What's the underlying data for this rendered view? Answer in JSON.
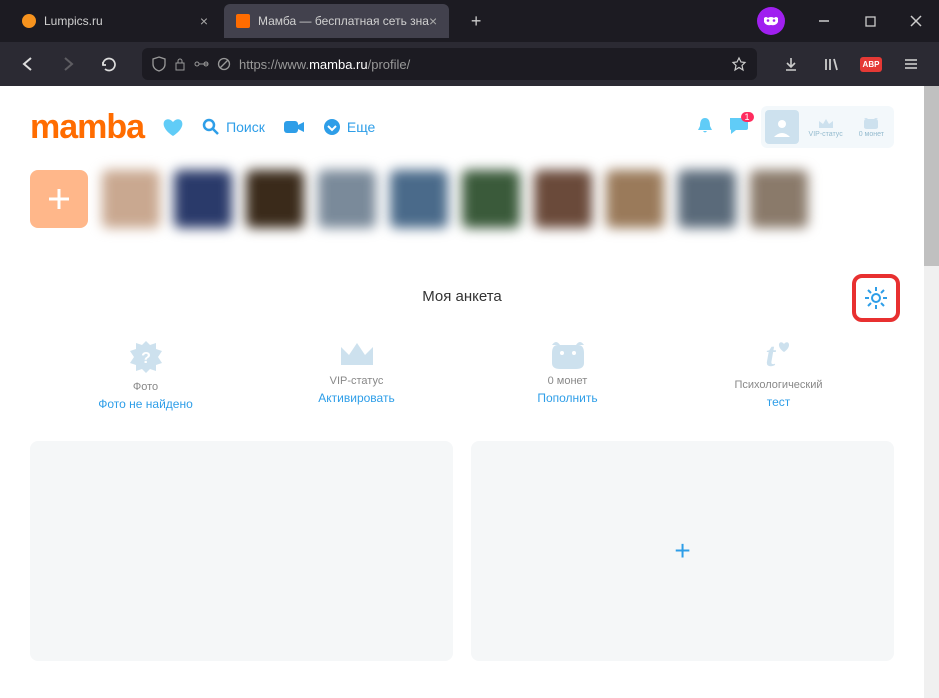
{
  "browser": {
    "tabs": [
      {
        "title": "Lumpics.ru",
        "active": false
      },
      {
        "title": "Мамба — бесплатная сеть зна",
        "active": true
      }
    ],
    "url_prefix": "https://www.",
    "url_domain": "mamba.ru",
    "url_path": "/profile/"
  },
  "header": {
    "logo": "mamba",
    "nav": {
      "search": "Поиск",
      "more": "Еще"
    },
    "user": {
      "vip": "VIP-статус",
      "coins": "0 монет"
    },
    "messages_badge": "1"
  },
  "section_title": "Моя анкета",
  "cards": {
    "photo": {
      "label": "Фото",
      "action": "Фото не найдено"
    },
    "vip": {
      "label": "VIP-статус",
      "action": "Активировать"
    },
    "coins": {
      "label": "0 монет",
      "action": "Пополнить"
    },
    "test": {
      "label": "Психологический",
      "action": "тест"
    }
  },
  "photo_colors": [
    "#c9a890",
    "#2a3a6a",
    "#3a2a1a",
    "#7a8a9a",
    "#4a6a8a",
    "#3a5a3a",
    "#6a4a3a",
    "#9a7a5a",
    "#5a6a7a",
    "#8a7a6a"
  ]
}
